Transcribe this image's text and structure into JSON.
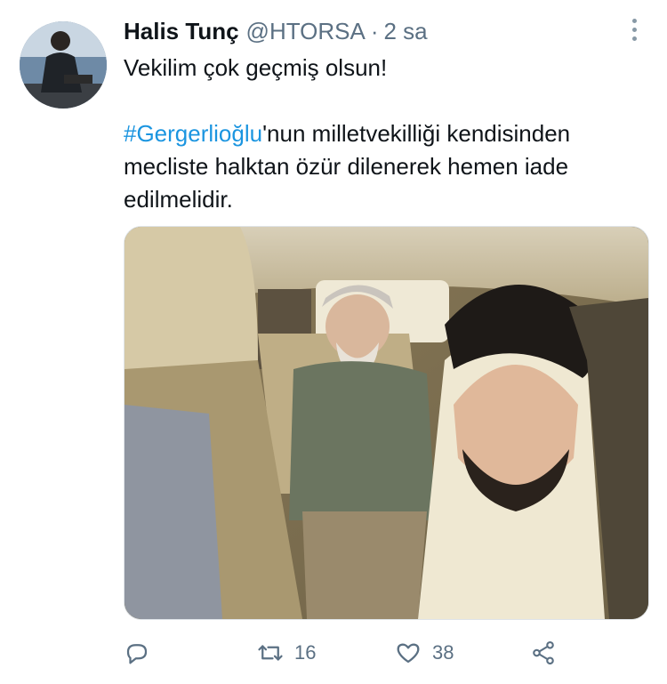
{
  "tweet": {
    "author_name": "Halis Tunç",
    "handle": "@HTORSA",
    "separator": "·",
    "time": "2 sa",
    "text_line1": "Vekilim çok geçmiş olsun!",
    "hashtag": "#Gergerlioğlu",
    "text_rest": "'nun milletvekilliği kendisinden mecliste halktan özür dilenerek hemen iade edilmelidir.",
    "media_icon": "photo-car-selfie-icon"
  },
  "actions": {
    "reply_icon": "reply-icon",
    "retweet_icon": "retweet-icon",
    "retweet_count": "16",
    "like_icon": "heart-icon",
    "like_count": "38",
    "share_icon": "share-icon"
  },
  "colors": {
    "text": "#0f1419",
    "secondary": "#5b7083",
    "link": "#1b95e0",
    "icon": "#5b7083"
  }
}
